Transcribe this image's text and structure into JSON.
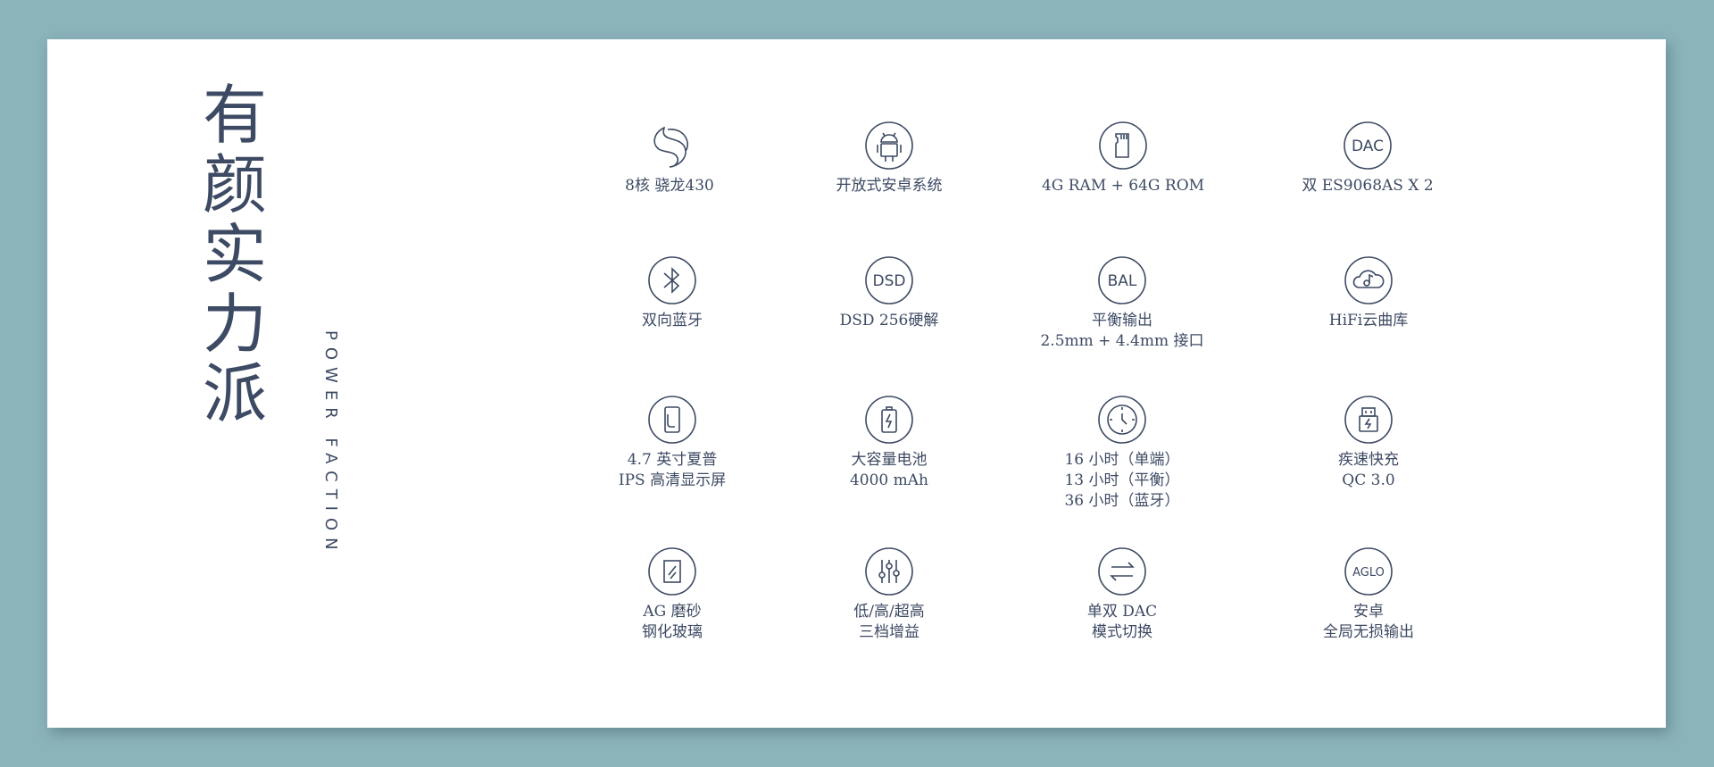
{
  "headline": "有颜实力派",
  "subheadline": "POWER FACTION",
  "icon_color": "#3d4a63",
  "features": [
    {
      "icon": "snapdragon-icon",
      "label": "8核 骁龙430"
    },
    {
      "icon": "android-icon",
      "label": "开放式安卓系统"
    },
    {
      "icon": "sd-card-icon",
      "label": "4G RAM + 64G ROM"
    },
    {
      "icon": "dac-icon",
      "icon_text": "DAC",
      "label": "双 ES9068AS X 2"
    },
    {
      "icon": "bluetooth-icon",
      "label": "双向蓝牙"
    },
    {
      "icon": "dsd-icon",
      "icon_text": "DSD",
      "label": "DSD 256硬解"
    },
    {
      "icon": "bal-icon",
      "icon_text": "BAL",
      "label": "平衡输出\n2.5mm + 4.4mm 接口"
    },
    {
      "icon": "cloud-music-icon",
      "label": "HiFi云曲库"
    },
    {
      "icon": "phone-screen-icon",
      "label": "4.7 英寸夏普\nIPS 高清显示屏"
    },
    {
      "icon": "battery-icon",
      "label": "大容量电池\n4000 mAh"
    },
    {
      "icon": "clock-icon",
      "label": "16 小时（单端）\n13 小时（平衡）\n36 小时（蓝牙）"
    },
    {
      "icon": "fast-charge-icon",
      "label": "疾速快充\nQC 3.0"
    },
    {
      "icon": "ag-glass-icon",
      "label": "AG 磨砂\n钢化玻璃"
    },
    {
      "icon": "equalizer-icon",
      "label": "低/高/超高\n三档增益"
    },
    {
      "icon": "switch-arrows-icon",
      "label": "单双 DAC\n模式切换"
    },
    {
      "icon": "aglo-icon",
      "icon_text": "AGLO",
      "label": "安卓\n全局无损输出"
    }
  ]
}
